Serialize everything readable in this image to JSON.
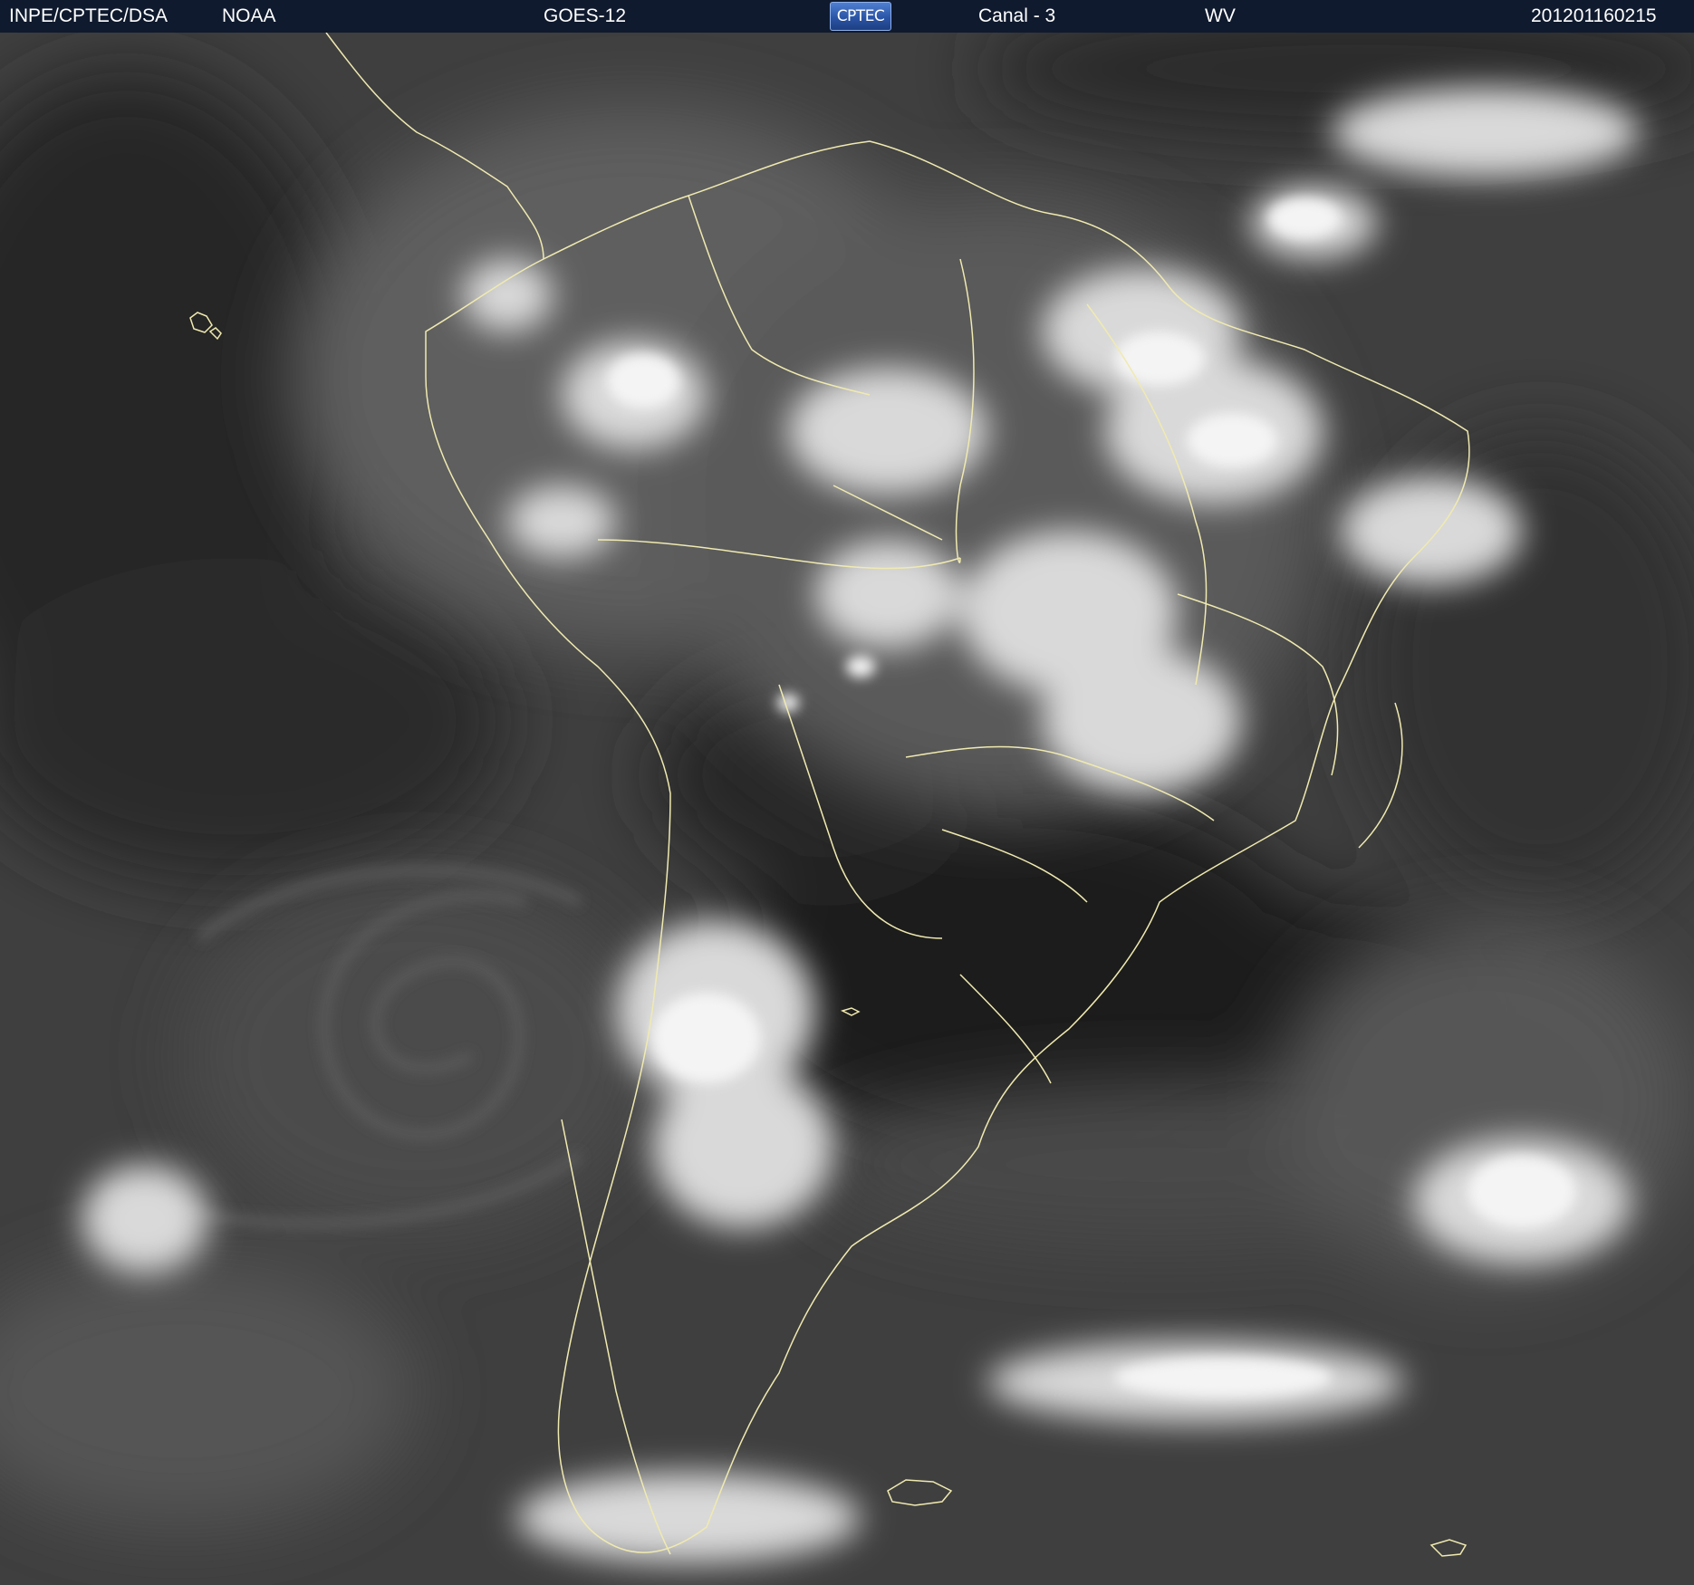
{
  "header": {
    "agency": "INPE/CPTEC/DSA",
    "source": "NOAA",
    "satellite": "GOES-12",
    "logo_text": "CPTEC",
    "channel": "Canal - 3",
    "band": "WV",
    "timestamp": "201201160215"
  },
  "colors": {
    "header_bg": "#0f1a2e",
    "background_gray": "#3d3d3d",
    "cloud_white": "#f2f2f2",
    "dry_dark": "#1c1c1c",
    "border_line": "#f0eab0"
  },
  "image": {
    "type": "satellite water-vapor image",
    "region": "South America"
  }
}
